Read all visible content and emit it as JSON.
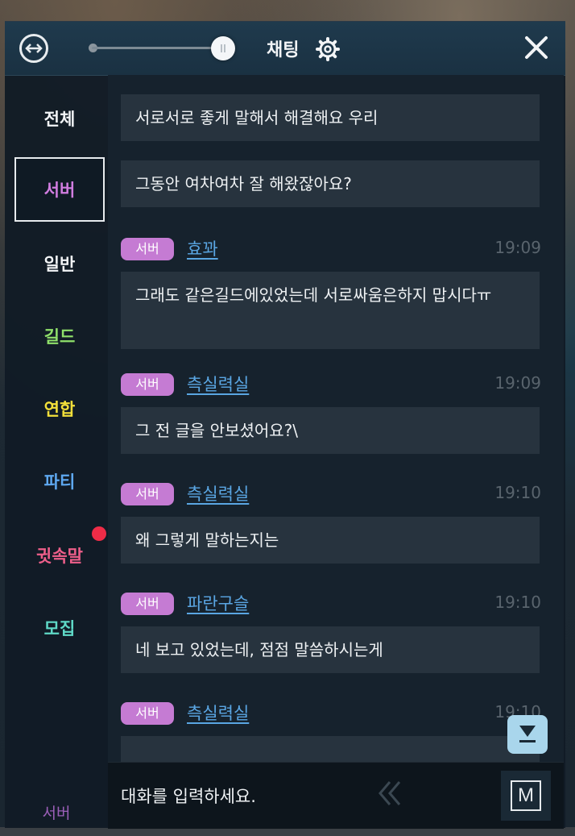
{
  "header": {
    "title": "채팅",
    "opacity_fraction": 0.96
  },
  "sidebar": {
    "tabs": [
      {
        "label": "전체",
        "color": "#f2f4f6",
        "active": false
      },
      {
        "label": "서버",
        "color": "#d17de0",
        "active": true
      },
      {
        "label": "일반",
        "color": "#f2f4f6",
        "active": false
      },
      {
        "label": "길드",
        "color": "#8fe06a",
        "active": false
      },
      {
        "label": "연합",
        "color": "#f2df3a",
        "active": false
      },
      {
        "label": "파티",
        "color": "#5ea8f0",
        "active": false
      },
      {
        "label": "귓속말",
        "color": "#ee5f8a",
        "active": false
      },
      {
        "label": "모집",
        "color": "#5fd9c7",
        "active": false
      }
    ],
    "current_channel": "서버"
  },
  "messages": [
    {
      "text": "서로서로 좋게 말해서 해결해요 우리"
    },
    {
      "text": "그동안 여차여차 잘 해왔잖아요?"
    },
    {
      "badge": "서버",
      "user": "효꽈",
      "time": "19:09",
      "text": "그래도 같은길드에있었는데 서로싸움은하지 맙시다ㅠ"
    },
    {
      "badge": "서버",
      "user": "측실력실",
      "time": "19:09",
      "text": "그 전 글을 안보셨어요?\\"
    },
    {
      "badge": "서버",
      "user": "측실력실",
      "time": "19:10",
      "text": "왜 그렇게 말하는지는"
    },
    {
      "badge": "서버",
      "user": "파란구슬",
      "time": "19:10",
      "text": "네 보고 있었는데, 점점 말씀하시는게"
    },
    {
      "badge": "서버",
      "user": "측실력실",
      "time": "19:10",
      "text": ""
    }
  ],
  "input": {
    "placeholder": "대화를 입력하세요."
  },
  "buttons": {
    "macro_label": "M"
  },
  "colors": {
    "accent_badge": "#c57bd3",
    "username": "#5aa6e3",
    "notification": "#ef2c47"
  },
  "icons": [
    "move-icon",
    "gear-icon",
    "close-icon",
    "scroll-down-icon",
    "chevron-left-icon"
  ]
}
